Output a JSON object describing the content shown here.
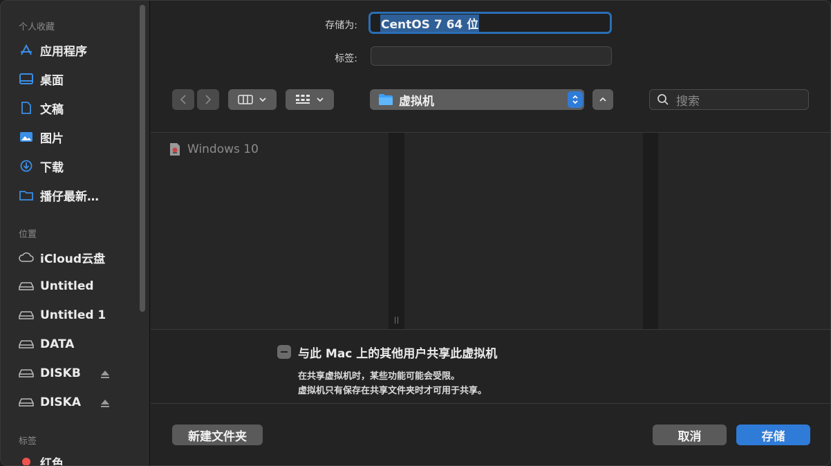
{
  "colors": {
    "accent": "#2f7bd8",
    "save_button": "#2f7bd8",
    "folder_blue": "#3aa0f5",
    "tag_red": "#f0524d"
  },
  "sidebar": {
    "favorites_header": "个人收藏",
    "favorites": [
      {
        "label": "应用程序",
        "icon": "applications-icon"
      },
      {
        "label": "桌面",
        "icon": "desktop-icon"
      },
      {
        "label": "文稿",
        "icon": "document-icon"
      },
      {
        "label": "图片",
        "icon": "pictures-icon"
      },
      {
        "label": "下载",
        "icon": "download-icon"
      },
      {
        "label": "播仔最新…",
        "icon": "folder-icon"
      }
    ],
    "locations_header": "位置",
    "locations": [
      {
        "label": "iCloud云盘",
        "icon": "icloud-icon"
      },
      {
        "label": "Untitled",
        "icon": "drive-icon"
      },
      {
        "label": "Untitled 1",
        "icon": "drive-icon"
      },
      {
        "label": "DATA",
        "icon": "drive-icon"
      },
      {
        "label": "DISKB",
        "icon": "drive-icon",
        "eject": true
      },
      {
        "label": "DISKA",
        "icon": "drive-icon",
        "eject": true
      }
    ],
    "tags_header": "标签",
    "tags": [
      {
        "label": "红色",
        "color": "#f0524d"
      }
    ]
  },
  "form": {
    "save_as_label": "存储为:",
    "save_as_value": "CentOS 7 64 位",
    "tags_label": "标签:",
    "tags_value": ""
  },
  "toolbar": {
    "location": "虚拟机",
    "search_placeholder": "搜索"
  },
  "browser": {
    "items": [
      {
        "name": "Windows 10",
        "icon": "vm-file-icon"
      }
    ]
  },
  "share": {
    "label": "与此 Mac 上的其他用户共享此虚拟机",
    "note_line1": "在共享虚拟机时，某些功能可能会受限。",
    "note_line2": "虚拟机只有保存在共享文件夹时才可用于共享。"
  },
  "buttons": {
    "new_folder": "新建文件夹",
    "cancel": "取消",
    "save": "存储"
  }
}
